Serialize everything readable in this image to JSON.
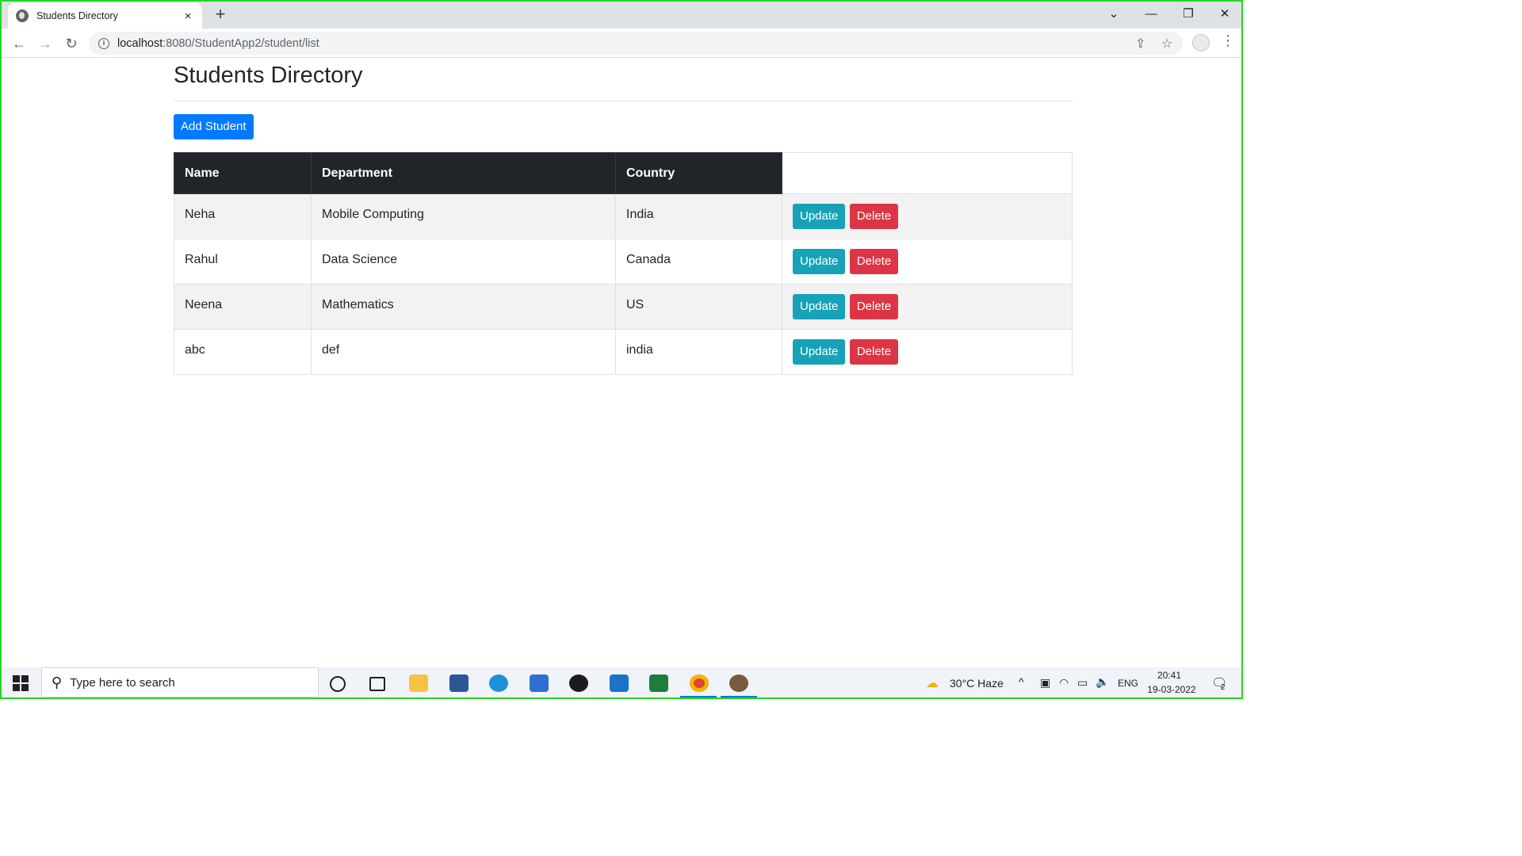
{
  "browser": {
    "tab_title": "Students Directory",
    "tab_close": "×",
    "new_tab": "+",
    "url_host": "localhost",
    "url_rest": ":8080/StudentApp2/student/list"
  },
  "page": {
    "title": "Students Directory",
    "add_button": "Add Student",
    "table": {
      "headers": [
        "Name",
        "Department",
        "Country"
      ],
      "rows": [
        {
          "name": "Neha",
          "department": "Mobile Computing",
          "country": "India"
        },
        {
          "name": "Rahul",
          "department": "Data Science",
          "country": "Canada"
        },
        {
          "name": "Neena",
          "department": "Mathematics",
          "country": "US"
        },
        {
          "name": "abc",
          "department": "def",
          "country": "india"
        }
      ],
      "update_label": "Update",
      "delete_label": "Delete"
    }
  },
  "taskbar": {
    "search_placeholder": "Type here to search",
    "weather": "30°C  Haze",
    "language": "ENG",
    "time": "20:41",
    "date": "19-03-2022",
    "notification_count": "2"
  },
  "colors": {
    "primary": "#007bff",
    "info": "#17a2b8",
    "danger": "#dc3545",
    "header_dark": "#212529"
  }
}
